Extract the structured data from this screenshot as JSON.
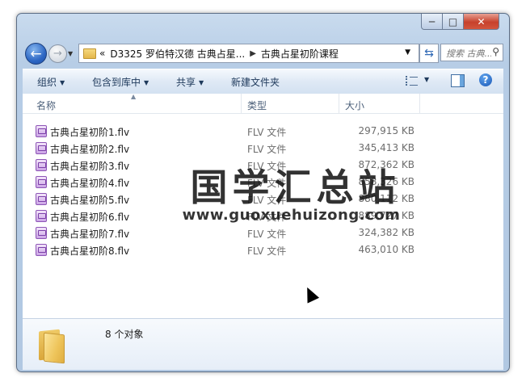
{
  "window": {
    "minimize": "─",
    "maximize": "□",
    "close": "✕"
  },
  "nav": {
    "back": "←",
    "forward": "→",
    "overflow": "«",
    "path": [
      "D3325 罗伯特汉德 古典占星...",
      "古典占星初阶课程"
    ],
    "search_placeholder": "搜索 古典..."
  },
  "toolbar": {
    "organize": "组织",
    "include_in_library": "包含到库中",
    "share": "共享",
    "new_folder": "新建文件夹"
  },
  "columns": {
    "name": "名称",
    "type": "类型",
    "size": "大小"
  },
  "files": [
    {
      "name": "古典占星初阶1.flv",
      "type": "FLV 文件",
      "size": "297,915 KB"
    },
    {
      "name": "古典占星初阶2.flv",
      "type": "FLV 文件",
      "size": "345,413 KB"
    },
    {
      "name": "古典占星初阶3.flv",
      "type": "FLV 文件",
      "size": "872,362 KB"
    },
    {
      "name": "古典占星初阶4.flv",
      "type": "FLV 文件",
      "size": "858,326 KB"
    },
    {
      "name": "古典占星初阶5.flv",
      "type": "FLV 文件",
      "size": "880,112 KB"
    },
    {
      "name": "古典占星初阶6.flv",
      "type": "FLV 文件",
      "size": "889,727 KB"
    },
    {
      "name": "古典占星初阶7.flv",
      "type": "FLV 文件",
      "size": "324,382 KB"
    },
    {
      "name": "古典占星初阶8.flv",
      "type": "FLV 文件",
      "size": "463,010 KB"
    }
  ],
  "status": {
    "count": "8 个对象"
  },
  "watermark": {
    "cn": "国学汇总站",
    "url": "www.guoxuehuizong.com"
  }
}
